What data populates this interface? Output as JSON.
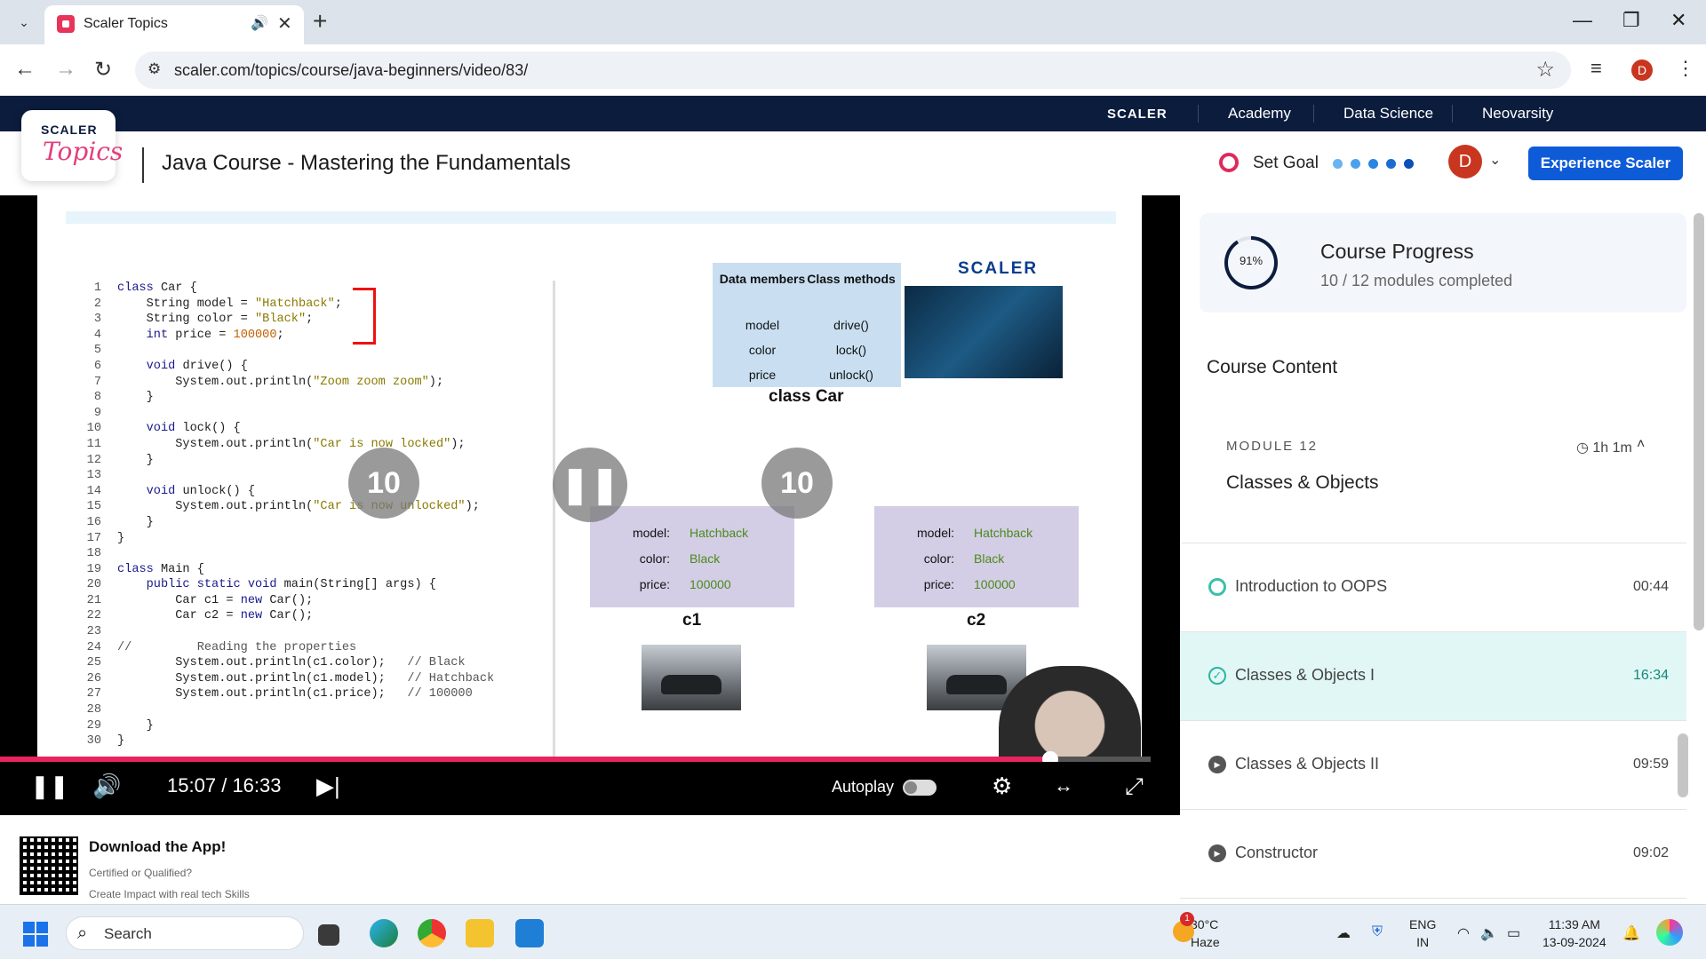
{
  "browser": {
    "tab_title": "Scaler Topics",
    "url": "scaler.com/topics/course/java-beginners/video/83/",
    "profile_initial": "D"
  },
  "site": {
    "top_links": [
      "SCALER",
      "Academy",
      "Data Science",
      "Neovarsity"
    ],
    "logo_line1": "SCALER",
    "logo_line2": "Topics",
    "course_title": "Java Course - Mastering the Fundamentals",
    "set_goal": "Set Goal",
    "user_initial": "D",
    "cta": "Experience Scaler"
  },
  "slide": {
    "table": {
      "col1_header": "Data members",
      "col2_header": "Class methods",
      "members": [
        "model",
        "color",
        "price"
      ],
      "methods": [
        "drive()",
        "lock()",
        "unlock()"
      ]
    },
    "class_label": "class Car",
    "brand": "SCALER",
    "objects": [
      {
        "label": "c1",
        "model": "Hatchback",
        "color": "Black",
        "price": "100000"
      },
      {
        "label": "c2",
        "model": "Hatchback",
        "color": "Black",
        "price": "100000"
      }
    ],
    "keys": [
      "model:",
      "color:",
      "price:"
    ],
    "overlay_rewind": "10",
    "overlay_forward": "10"
  },
  "player": {
    "current_time": "15:07",
    "separator": "/",
    "duration": "16:33",
    "autoplay_label": "Autoplay",
    "progress_fraction": 0.913
  },
  "sidebar": {
    "progress_pct": "91%",
    "progress_title": "Course Progress",
    "progress_sub": "10 / 12 modules completed",
    "content_title": "Course Content",
    "module_label": "MODULE 12",
    "module_time": "1h 1m",
    "module_title": "Classes & Objects",
    "lessons": [
      {
        "title": "Introduction to OOPS",
        "duration": "00:44",
        "state": "in-progress"
      },
      {
        "title": "Classes & Objects I",
        "duration": "16:34",
        "state": "completed"
      },
      {
        "title": "Classes & Objects II",
        "duration": "09:59",
        "state": "unplayed"
      },
      {
        "title": "Constructor",
        "duration": "09:02",
        "state": "unplayed"
      }
    ]
  },
  "app_strip": {
    "title": "Download the App!",
    "line1": "Certified or Qualified?",
    "line2": "Create Impact with real tech Skills"
  },
  "taskbar": {
    "search": "Search",
    "weather_temp": "30°C",
    "weather_desc": "Haze",
    "weather_badge": "1",
    "lang1": "ENG",
    "lang2": "IN",
    "time": "11:39 AM",
    "date": "13-09-2024"
  },
  "colors": {
    "brand_navy": "#0b1c3d",
    "cta_blue": "#0e5bd8",
    "progress_pink": "#e8245e",
    "active_lesson_bg": "#e1f7f6",
    "goal_red": "#e0295d"
  }
}
